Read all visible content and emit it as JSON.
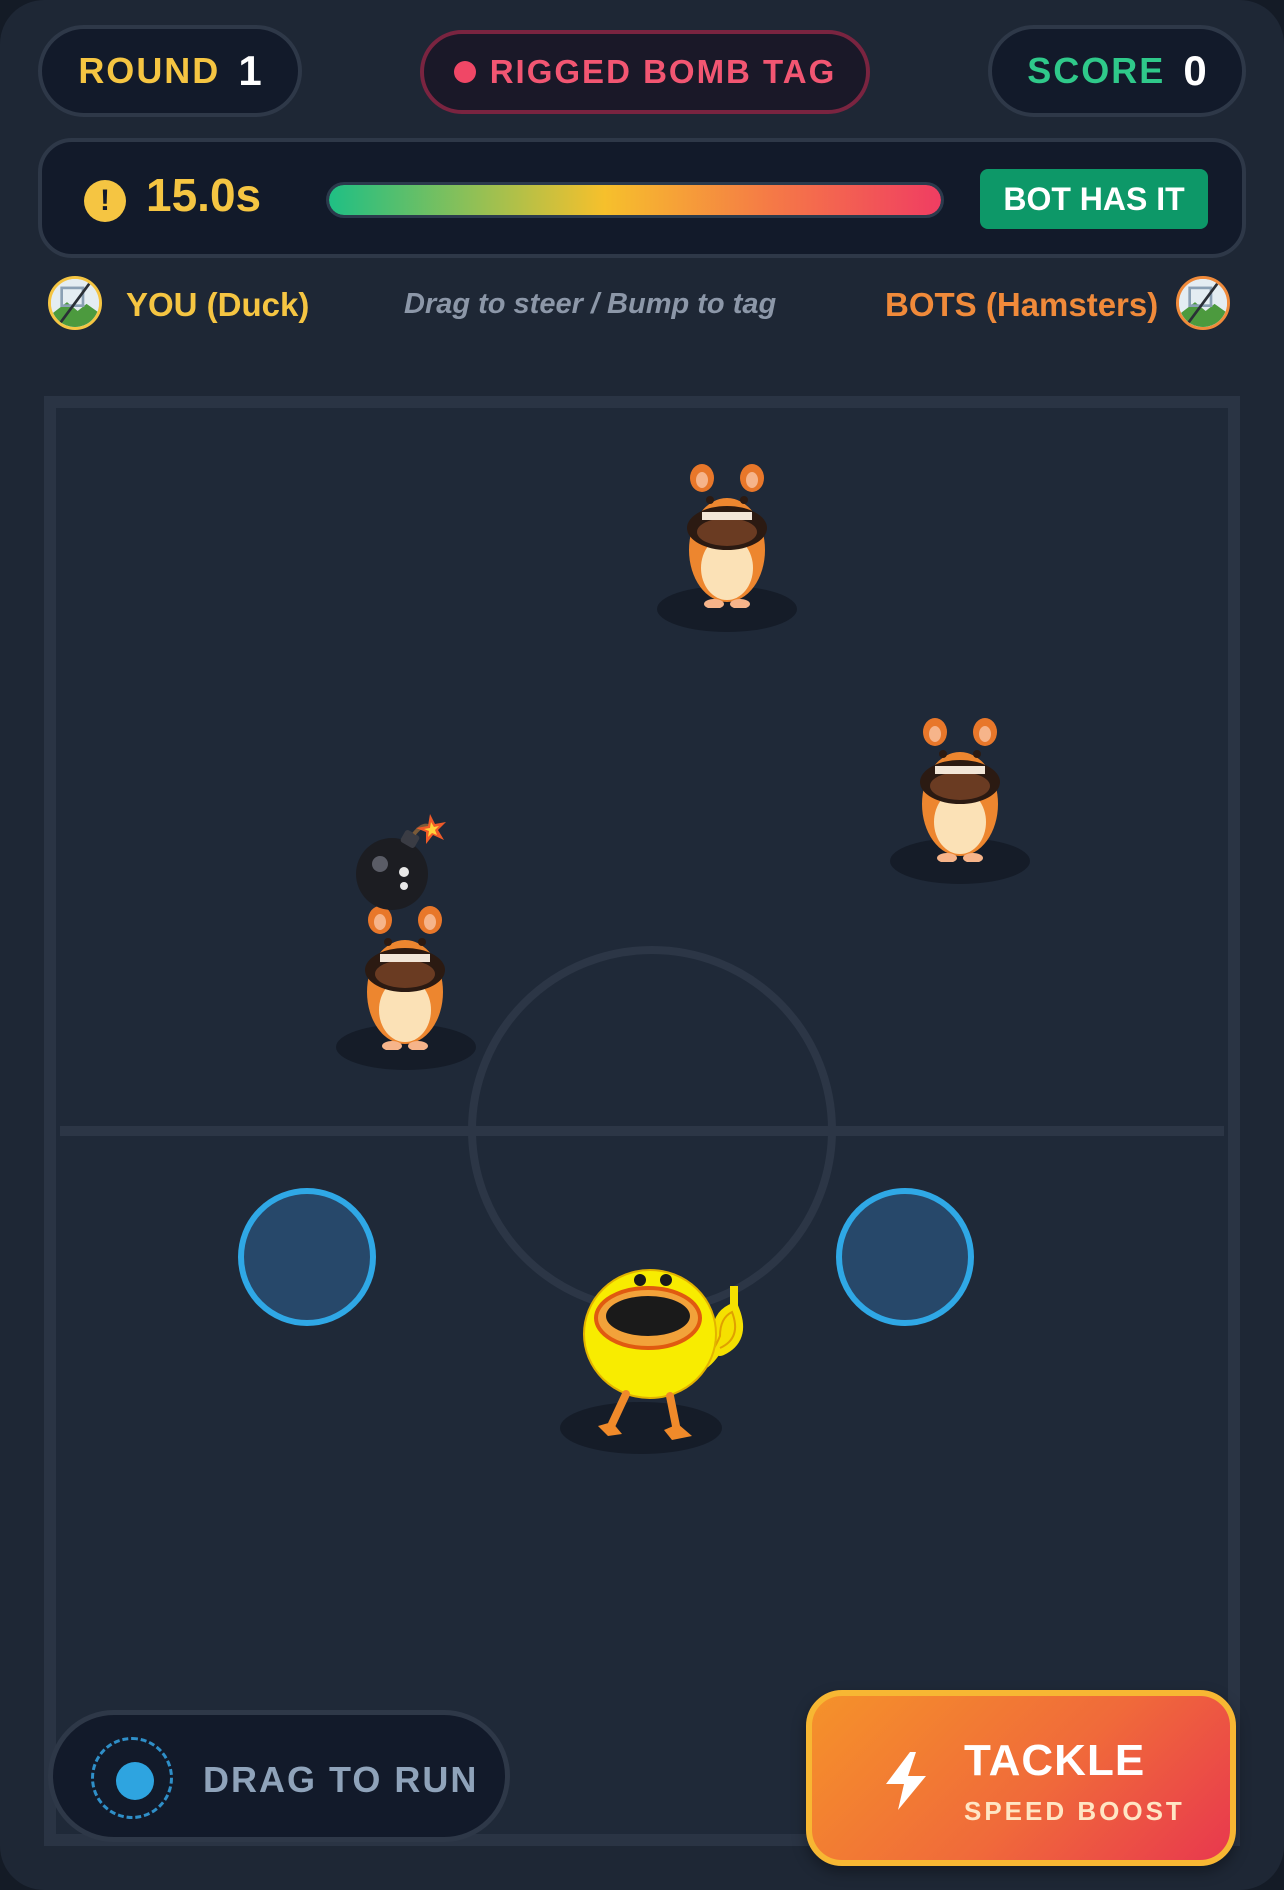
{
  "header": {
    "round_label": "ROUND",
    "round_value": "1",
    "mode_label": "RIGGED BOMB TAG",
    "score_label": "SCORE",
    "score_value": "0"
  },
  "timer": {
    "value": "15.0s",
    "progress_fraction": 1.0,
    "status_badge": "BOT HAS IT"
  },
  "players": {
    "you_label": "YOU (Duck)",
    "hint": "Drag to steer / Bump to tag",
    "bots_label": "BOTS (Hamsters)"
  },
  "controls": {
    "drag_label": "DRAG TO RUN",
    "tackle_label": "TACKLE",
    "tackle_sub": "SPEED BOOST"
  },
  "colors": {
    "accent_yellow": "#f5c542",
    "accent_green": "#2fc98a",
    "accent_red": "#f25672",
    "accent_orange": "#f08a3a",
    "zone_blue": "#2fa8e6"
  },
  "icons": [
    "warning-icon",
    "bolt-icon",
    "bomb-icon",
    "duck-character",
    "hamster-character"
  ]
}
